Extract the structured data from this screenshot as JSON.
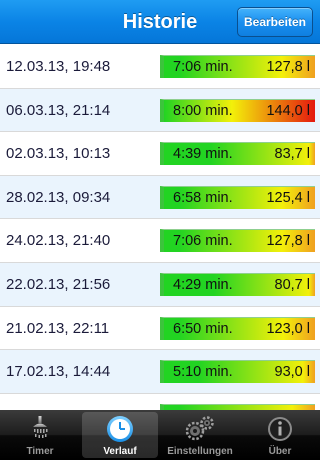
{
  "navbar": {
    "title": "Historie",
    "edit_label": "Bearbeiten"
  },
  "history": [
    {
      "date": "12.03.13, 19:48",
      "duration": "7:06 min.",
      "volume": "127,8 l",
      "level": 0.74
    },
    {
      "date": "06.03.13, 21:14",
      "duration": "8:00 min.",
      "volume": "144,0 l",
      "level": 1.0
    },
    {
      "date": "02.03.13, 10:13",
      "duration": "4:39 min.",
      "volume": "83,7 l",
      "level": 0.15
    },
    {
      "date": "28.02.13, 09:34",
      "duration": "6:58 min.",
      "volume": "125,4 l",
      "level": 0.72
    },
    {
      "date": "24.02.13, 21:40",
      "duration": "7:06 min.",
      "volume": "127,8 l",
      "level": 0.74
    },
    {
      "date": "22.02.13, 21:56",
      "duration": "4:29 min.",
      "volume": "80,7 l",
      "level": 0.12
    },
    {
      "date": "21.02.13, 22:11",
      "duration": "6:50 min.",
      "volume": "123,0 l",
      "level": 0.7
    },
    {
      "date": "17.02.13, 14:44",
      "duration": "5:10 min.",
      "volume": "93,0 l",
      "level": 0.28
    },
    {
      "date": "",
      "duration": "",
      "volume": "",
      "level": 0.5
    }
  ],
  "colors": {
    "low": "#22d422",
    "mid": "#f3f00a",
    "high": "#e4190f",
    "row_alt": "#eaf4fd",
    "nav": "#0b84e6"
  },
  "tabbar": {
    "tabs": [
      {
        "label": "Timer",
        "icon": "shower-icon",
        "active": false
      },
      {
        "label": "Verlauf",
        "icon": "clock-icon",
        "active": true
      },
      {
        "label": "Einstellungen",
        "icon": "gears-icon",
        "active": false
      },
      {
        "label": "Über",
        "icon": "info-icon",
        "active": false
      }
    ]
  }
}
